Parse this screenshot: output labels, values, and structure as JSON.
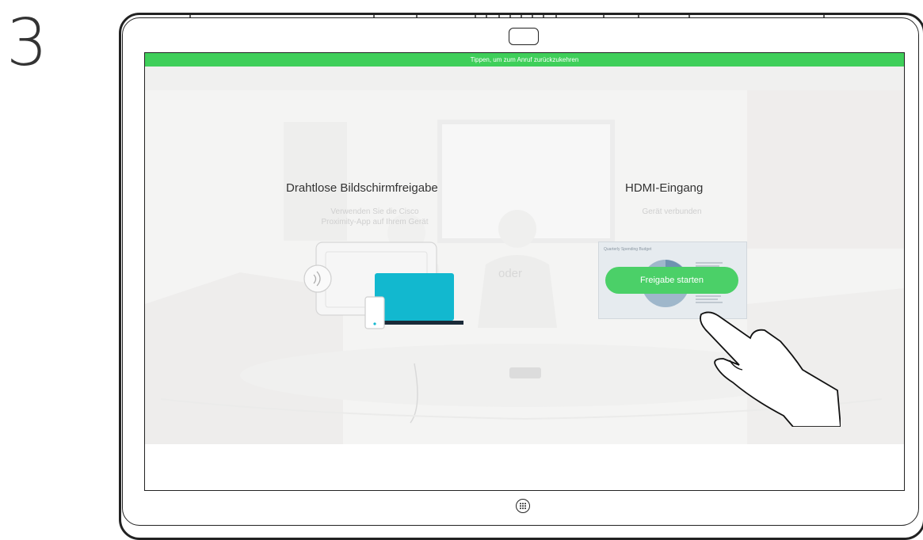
{
  "step": {
    "number": "3"
  },
  "banner": {
    "text": "Tippen, um zum Anruf zurückzukehren"
  },
  "wireless": {
    "title": "Drahtlose Bildschirmfreigabe",
    "subtitle_line1": "Verwenden Sie die Cisco",
    "subtitle_line2": "Proximity-App auf Ihrem Gerät"
  },
  "separator": {
    "text": "oder"
  },
  "hdmi": {
    "title": "HDMI-Eingang",
    "subtitle": "Gerät verbunden",
    "preview_title": "Quarterly Spending Budget",
    "share_button_label": "Freigabe starten"
  },
  "icons": {
    "camera": "camera-icon",
    "home": "home-button-icon",
    "proximity": "proximity-signal-icon",
    "laptop": "laptop-icon",
    "phone": "phone-icon",
    "hand": "tapping-hand-icon"
  },
  "colors": {
    "banner": "#3fcf5a",
    "share_button": "#4bd068",
    "laptop": "#12b8cf"
  }
}
